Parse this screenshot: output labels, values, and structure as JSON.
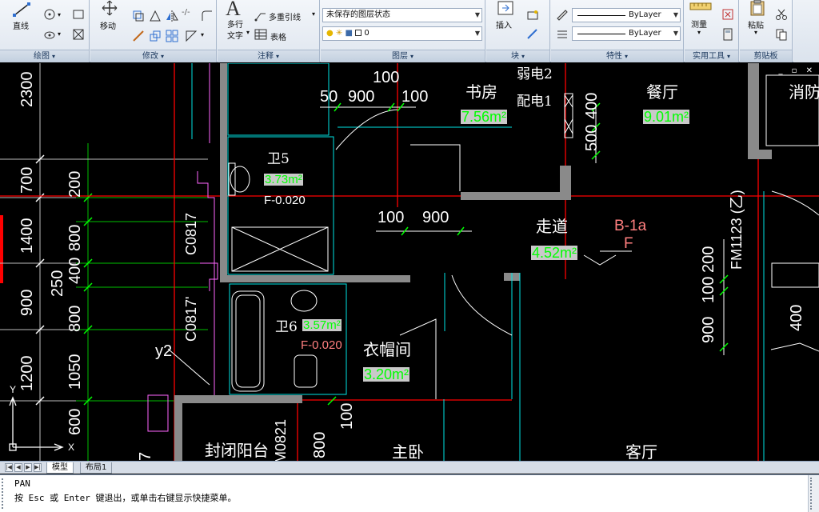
{
  "ribbon": {
    "draw": {
      "title": "绘图",
      "line_label": "直线"
    },
    "modify": {
      "title": "修改",
      "move_label": "移动"
    },
    "annotation": {
      "title": "注释",
      "mtext_label_1": "多行",
      "mtext_label_2": "文字",
      "mleader_label": "多重引线",
      "table_label": "表格"
    },
    "layers": {
      "title": "图层",
      "layer_state": "未保存的图层状态",
      "current_layer": "0"
    },
    "block": {
      "title": "块",
      "insert_label": "插入"
    },
    "properties": {
      "title": "特性",
      "linetype": "ByLayer",
      "lineweight": "ByLayer"
    },
    "utilities": {
      "title": "实用工具",
      "measure_label": "测量"
    },
    "clipboard": {
      "title": "剪贴板",
      "paste_label": "粘贴"
    }
  },
  "drawing": {
    "rooms": {
      "study": "书房",
      "study_area": "7.56m²",
      "dining": "餐厅",
      "dining_area": "9.01m²",
      "fire": "消防",
      "wc5": "卫5",
      "wc5_area": "3.73m²",
      "wc5_floor": "F-0.020",
      "wc6": "卫6",
      "wc6_area": "3.57m²",
      "wc6_floor": "F-0.020",
      "corridor": "走道",
      "corridor_area": "4.52m²",
      "closet": "衣帽间",
      "closet_area": "3.20m²",
      "balcony": "封闭阳台",
      "master": "主卧",
      "living": "客厅",
      "weak_box": "弱电2",
      "power_box": "配电1",
      "mark_b1a": "B-1a",
      "mark_f": "F"
    },
    "tags": {
      "c0817_a": "C0817",
      "c0817_b": "C0817'",
      "m0821": "M0821",
      "fm1123": "FM1123 (乙)",
      "y2": "y2"
    },
    "dims_left_white": [
      "2300",
      "700",
      "1400",
      "250",
      "900",
      "1200",
      "7"
    ],
    "dims_left_green": [
      "200",
      "800",
      "400",
      "800",
      "1050",
      "600"
    ],
    "dims_top": [
      "50",
      "900",
      "100",
      "100",
      "100",
      "900"
    ],
    "dims_right": [
      "400",
      "500",
      "200",
      "100",
      "900",
      "400"
    ],
    "dims_bottom": [
      "100",
      "800"
    ],
    "axis_x": "X",
    "axis_y": "Y"
  },
  "tabs": {
    "model": "模型",
    "layout1": "布局1"
  },
  "command": {
    "line1": "PAN",
    "line2": "按 Esc 或 Enter 键退出，或单击右键显示快捷菜单。"
  }
}
